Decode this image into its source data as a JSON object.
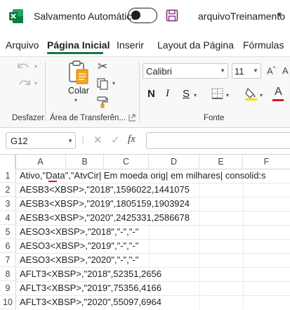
{
  "title_bar": {
    "autosave_label": "Salvamento Automático",
    "filename": "arquivoTreinamento",
    "colors": {
      "excel_green": "#107c41",
      "save_purple": "#8c2f8c"
    }
  },
  "tabs": [
    "Arquivo",
    "Página Inicial",
    "Inserir",
    "Layout da Página",
    "Fórmulas"
  ],
  "ribbon": {
    "undo_group_label": "Desfazer",
    "clipboard_group_label": "Área de Transferên...",
    "paste_label": "Colar",
    "font_group_label": "Fonte",
    "font_name": "Calibri",
    "font_size": "11",
    "bold": "N",
    "italic": "I",
    "underline": "S",
    "font_color_letter": "A",
    "colors": {
      "highlight": "#ffd800",
      "font_red": "#e81123"
    }
  },
  "formula_bar": {
    "name_box": "G12",
    "fx": "fx",
    "formula": ""
  },
  "grid": {
    "columns": [
      "A",
      "B",
      "C",
      "D",
      "E",
      "F"
    ],
    "rows": [
      {
        "n": "1",
        "text": "Ativo,\"Data\",\"AtvCir| Em moeda orig| em milhares| consolid:s"
      },
      {
        "n": "2",
        "text": "AESB3<XBSP>,\"2018\",1596022,1441075"
      },
      {
        "n": "3",
        "text": "AESB3<XBSP>,\"2019\",1805159,1903924"
      },
      {
        "n": "4",
        "text": "AESB3<XBSP>,\"2020\",2425331,2586678"
      },
      {
        "n": "5",
        "text": "AESO3<XBSP>,\"2018\",\"-\",\"-\""
      },
      {
        "n": "6",
        "text": "AESO3<XBSP>,\"2019\",\"-\",\"-\""
      },
      {
        "n": "7",
        "text": "AESO3<XBSP>,\"2020\",\"-\",\"-\""
      },
      {
        "n": "8",
        "text": "AFLT3<XBSP>,\"2018\",52351,2656"
      },
      {
        "n": "9",
        "text": "AFLT3<XBSP>,\"2019\",75356,4166"
      },
      {
        "n": "10",
        "text": "AFLT3<XBSP>,\"2020\",55097,6964"
      }
    ]
  }
}
